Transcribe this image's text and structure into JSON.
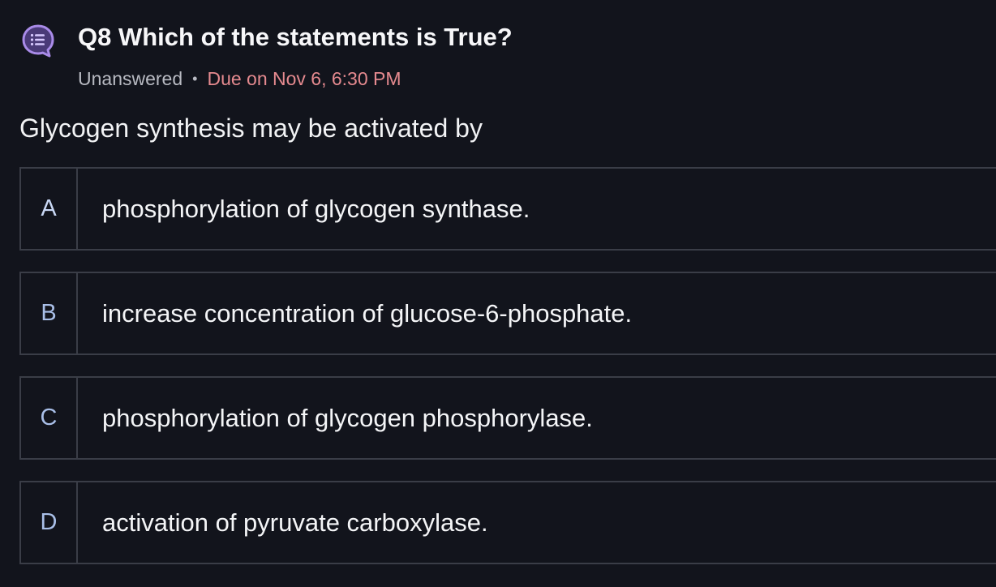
{
  "question": {
    "title": "Q8 Which of the statements is True?",
    "status": "Unanswered",
    "separator": "•",
    "due": "Due on Nov 6, 6:30 PM",
    "prompt": "Glycogen synthesis may be activated by",
    "icon": "question-list-icon"
  },
  "options": [
    {
      "letter": "A",
      "text": "phosphorylation of glycogen synthase."
    },
    {
      "letter": "B",
      "text": "increase concentration of glucose-6-phosphate."
    },
    {
      "letter": "C",
      "text": "phosphorylation of glycogen phosphorylase."
    },
    {
      "letter": "D",
      "text": "activation of pyruvate carboxylase."
    }
  ],
  "colors": {
    "background": "#12141c",
    "accent": "#a98be8",
    "due": "#e58a8f",
    "border": "#3a3d47",
    "letter": "#a9bfe8"
  }
}
